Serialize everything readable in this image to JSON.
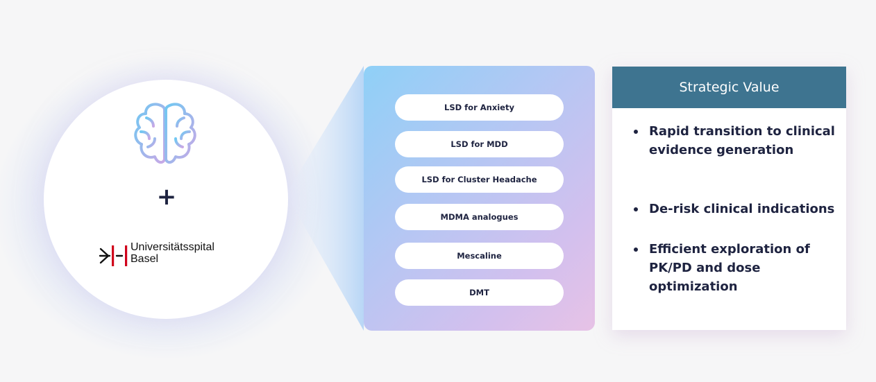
{
  "partner": {
    "plus": "+",
    "logo_line1": "Universitätsspital",
    "logo_line2": "Basel"
  },
  "indications": [
    "LSD for Anxiety",
    "LSD for MDD",
    "LSD for Cluster Headache",
    "MDMA analogues",
    "Mescaline",
    "DMT"
  ],
  "strategic_value": {
    "title": "Strategic Value",
    "bullets": [
      "Rapid transition to clinical evidence generation",
      "De-risk clinical indications",
      "Efficient exploration of PK/PD and dose optimization"
    ]
  },
  "colors": {
    "header": "#3e7490",
    "text": "#1e2340",
    "logo_red": "#d0021b"
  }
}
